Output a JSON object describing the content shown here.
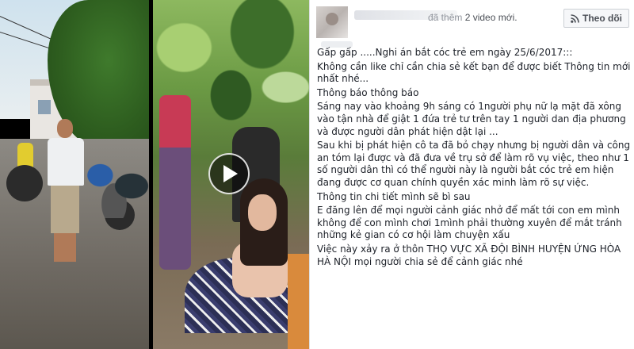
{
  "post": {
    "action_prefix": "đã thêm",
    "video_count": "2 video mới.",
    "follow_label": "Theo dõi",
    "paragraphs": [
      "Gấp gấp .....Nghi án bắt cóc trẻ em ngày 25/6/2017:::",
      "Không cần like chỉ cần chia sẻ kết bạn để được biết Thông tin mới nhất nhé...",
      "Thông báo thông báo",
      "Sáng nay vào khoảng 9h sáng có 1người phụ nữ lạ mặt đã xông vào tận nhà để giật 1 đứa trẻ tư trên tay 1 người dan địa phương và được người dân phát hiện dật lại ...",
      "Sau khi bị phát hiện cô ta đã bỏ chạy nhưng bị người dân và công an tóm lại được và đã đưa về trụ sở để làm rõ vụ việc, theo như 1 số người dân thì có thể người này là người bắt cóc trẻ em hiện đang được cơ quan chính quyền xác minh làm rõ sự việc.",
      "Thông tin chi tiết mình sẽ bì sau",
      "E đăng lên để mọi người cảnh giác nhở để mất tới con em mình không để con mình chơi 1mình phải thường xuyên để mắt tránh những kẻ gian có cơ hội làm chuyện xấu",
      "Việc này xảy ra ở thôn THỌ VỰC XÃ ĐỘI BÌNH HUYỆN ỨNG HÒA HÀ NỘI mọi người chia sẻ để cảnh giác nhé"
    ]
  },
  "icons": {
    "play": "play-icon",
    "follow": "rss-icon"
  },
  "colors": {
    "meta_text": "#90949c",
    "body_text": "#1d2129",
    "button_border": "#ccd0d5"
  }
}
